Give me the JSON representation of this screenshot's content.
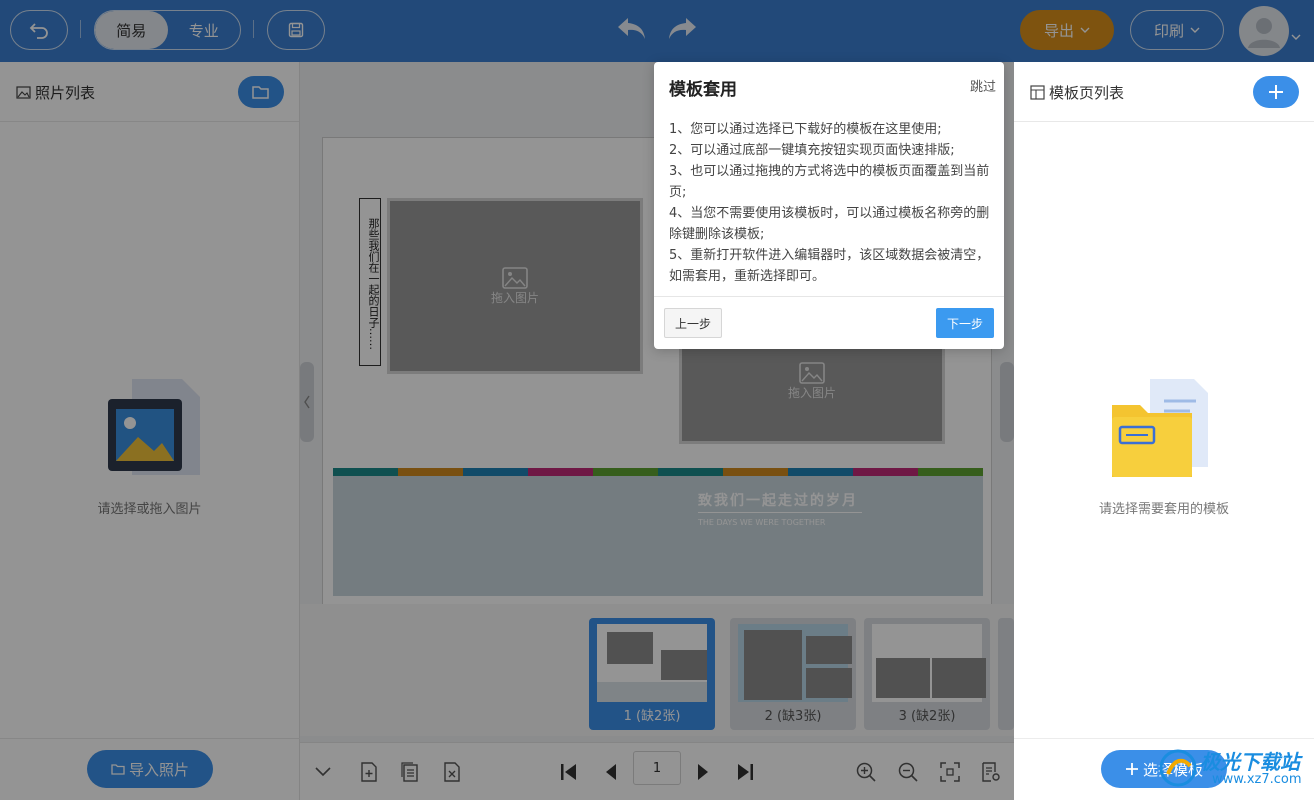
{
  "toolbar": {
    "back_icon": "undo-icon",
    "mode_simple": "简易",
    "mode_pro": "专业",
    "save_icon": "save-icon",
    "undo_icon": "undo-arrow-icon",
    "redo_icon": "redo-arrow-icon",
    "export_label": "导出",
    "print_label": "印刷",
    "accent_color": "#3b7fd0",
    "export_color": "#d9901a"
  },
  "left_panel": {
    "title": "照片列表",
    "empty_text": "请选择或拖入图片",
    "import_label": "导入照片"
  },
  "canvas": {
    "vertical_text": "那些我们在一起的日子……",
    "drop_hint_1": "拖入图片",
    "drop_hint_2": "拖入图片",
    "band_title": "致我们一起走过的岁月",
    "band_subtitle": "THE DAYS WE WERE TOGETHER",
    "stripe_colors": [
      "#1b8a8a",
      "#d08a1e",
      "#1e82b5",
      "#c02a77",
      "#5ea331",
      "#1b8a8a",
      "#d08a1e",
      "#1e82b5",
      "#c02a77",
      "#5ea331"
    ]
  },
  "thumbnails": [
    {
      "label": "1 (缺2张)",
      "active": true
    },
    {
      "label": "2 (缺3张)",
      "active": false
    },
    {
      "label": "3 (缺2张)",
      "active": false
    }
  ],
  "bottom_bar": {
    "page_number": "1"
  },
  "right_panel": {
    "title": "模板页列表",
    "empty_text": "请选择需要套用的模板",
    "select_label": "选择模板"
  },
  "popup": {
    "title": "模板套用",
    "skip": "跳过",
    "lines": [
      "1、您可以通过选择已下载好的模板在这里使用;",
      "2、可以通过底部一键填充按钮实现页面快速排版;",
      "3、也可以通过拖拽的方式将选中的模板页面覆盖到当前页;",
      "4、当您不需要使用该模板时，可以通过模板名称旁的删除键删除该模板;",
      "5、重新打开软件进入编辑器时，该区域数据会被清空，如需套用，重新选择即可。"
    ],
    "prev_label": "上一步",
    "next_label": "下一步"
  },
  "watermark": {
    "title": "极光下载站",
    "site": "www.xz7.com"
  }
}
